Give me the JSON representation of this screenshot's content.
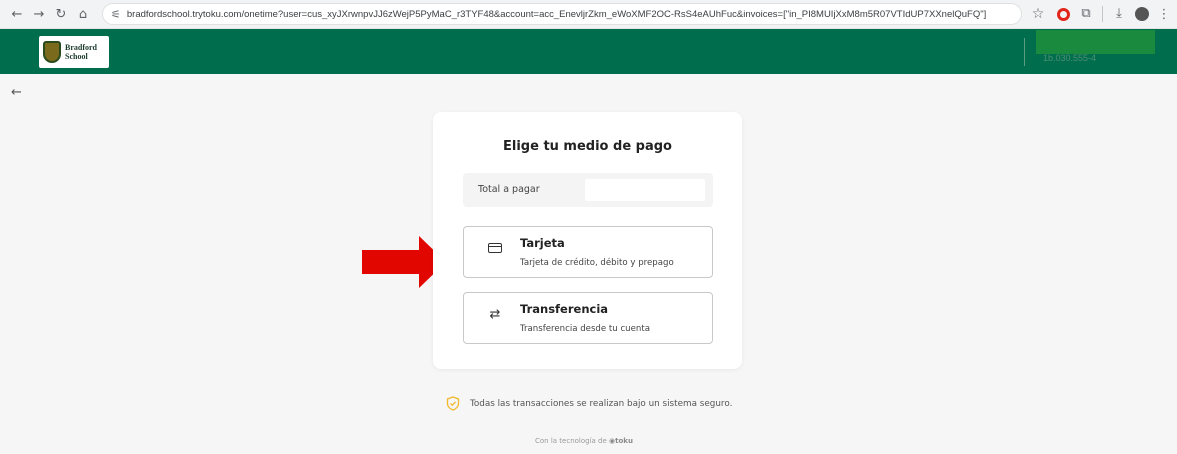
{
  "browser": {
    "url": "bradfordschool.trytoku.com/onetime?user=cus_xyJXrwnpvJJ6zWejP5PyMaC_r3TYF48&account=acc_EnevljrZkm_eWoXMF2OC-RsS4eAUhFuc&invoices=[\"in_PI8MUIjXxM8m5R07VTIdUP7XXnelQuFQ\"]",
    "icons": [
      "back-icon",
      "forward-icon",
      "reload-icon",
      "home-icon",
      "site-info-icon",
      "star-icon",
      "opera-icon",
      "extensions-icon",
      "download-icon",
      "profile-avatar",
      "menu-icon"
    ]
  },
  "header": {
    "school_name_line1": "Bradford",
    "school_name_line2": "School",
    "account_id": "1b.030.555-4",
    "brand_color": "#006e4d"
  },
  "payment": {
    "title": "Elige tu medio de pago",
    "total_label": "Total a pagar",
    "options": [
      {
        "title": "Tarjeta",
        "subtitle": "Tarjeta de crédito, débito y prepago",
        "icon": "credit-card-icon"
      },
      {
        "title": "Transferencia",
        "subtitle": "Transferencia desde tu cuenta",
        "icon": "transfer-arrows-icon"
      }
    ]
  },
  "footer": {
    "secure_text": "Todas las transacciones se realizan bajo un sistema seguro.",
    "powered_prefix": "Con la tecnología de",
    "powered_brand": "toku"
  },
  "colors": {
    "arrow": "#e10600",
    "shield": "#f2b72a"
  }
}
